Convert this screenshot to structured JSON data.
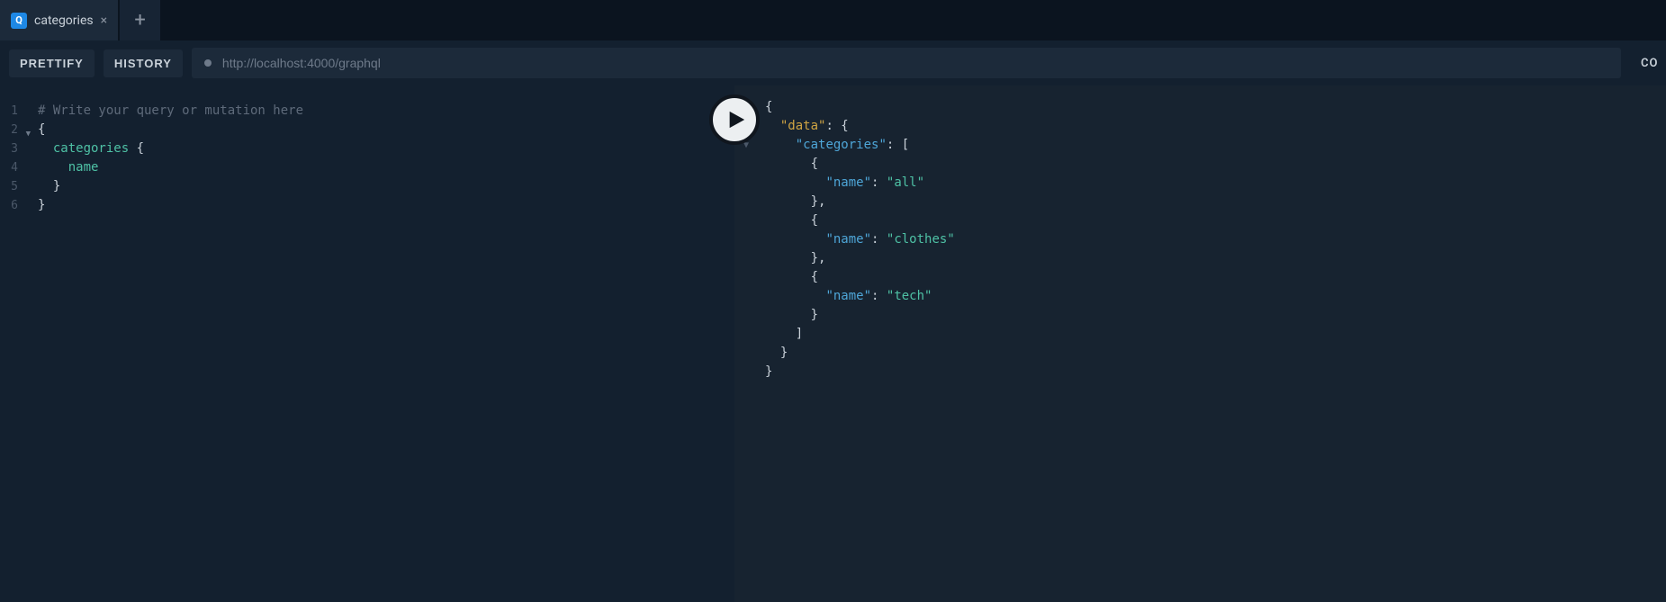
{
  "tabs": [
    {
      "badge": "Q",
      "title": "categories"
    }
  ],
  "toolbar": {
    "prettify": "PRETTIFY",
    "history": "HISTORY",
    "endpoint": "http://localhost:4000/graphql",
    "copy": "COP"
  },
  "query": {
    "comment": "# Write your query or mutation here",
    "root": "categories",
    "field": "name"
  },
  "response": {
    "rootKey": "data",
    "collectionKey": "categories",
    "itemKey": "name",
    "items": [
      "all",
      "clothes",
      "tech"
    ]
  }
}
